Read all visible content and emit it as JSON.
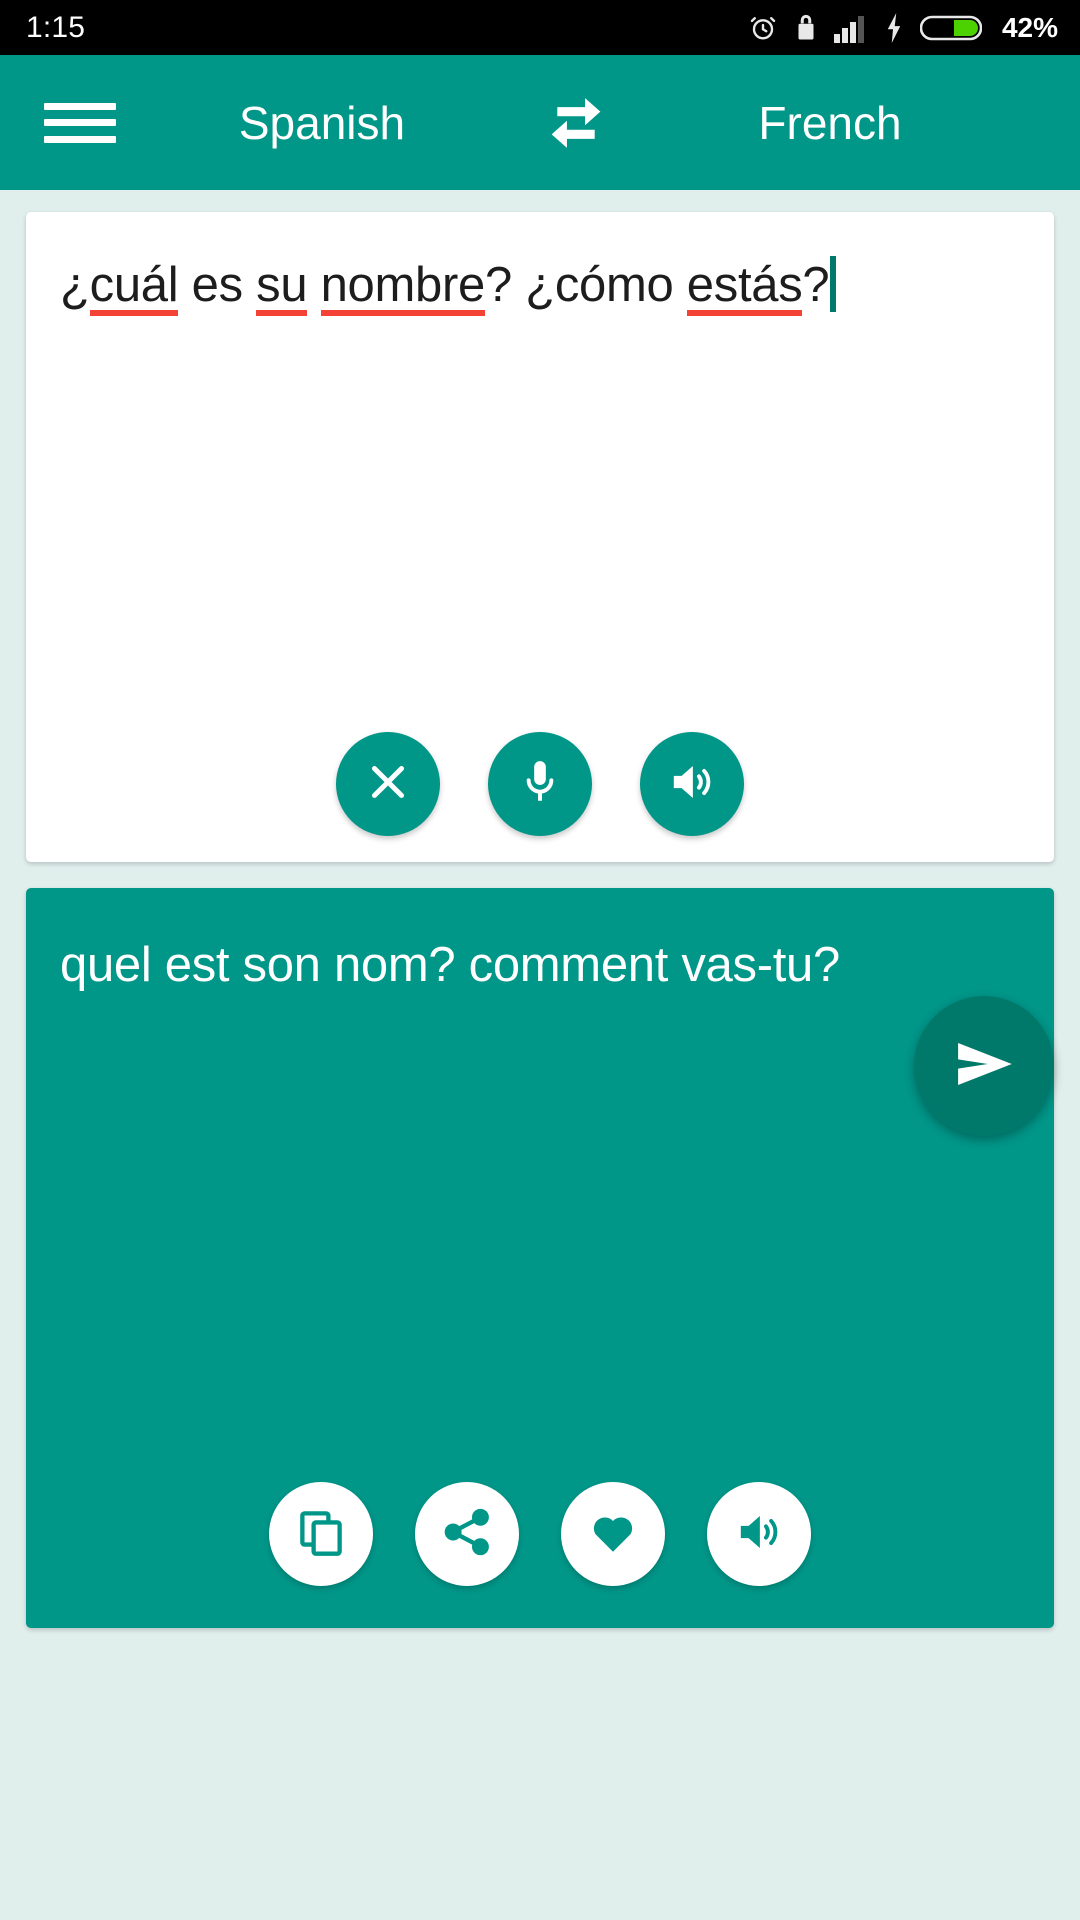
{
  "status_bar": {
    "clock": "1:15",
    "battery_percent": "42%",
    "icons": [
      "alarm-icon",
      "lock-icon",
      "signal-icon",
      "charging-bolt-icon",
      "battery-icon"
    ],
    "background": "#000000",
    "foreground": "#ffffff"
  },
  "app_bar": {
    "menu_label": "menu-icon",
    "source_language": "Spanish",
    "swap_label": "swap-languages-icon",
    "target_language": "French",
    "background": "#009688"
  },
  "source": {
    "text": "¿cuál es su nombre? ¿cómo estás?",
    "segments": [
      {
        "t": "¿",
        "misspelled": false
      },
      {
        "t": "cuál",
        "misspelled": true
      },
      {
        "t": " es ",
        "misspelled": false
      },
      {
        "t": "su",
        "misspelled": true
      },
      {
        "t": " ",
        "misspelled": false
      },
      {
        "t": "nombre",
        "misspelled": true
      },
      {
        "t": "? ¿cómo ",
        "misspelled": false
      },
      {
        "t": "estás",
        "misspelled": true
      },
      {
        "t": "?",
        "misspelled": false
      }
    ],
    "caret_color": "#00796b",
    "spellcheck_color": "#f44336",
    "actions": [
      {
        "name": "clear-button",
        "icon": "close-icon"
      },
      {
        "name": "voice-input-button",
        "icon": "microphone-icon"
      },
      {
        "name": "speak-source-button",
        "icon": "speaker-icon"
      }
    ]
  },
  "target": {
    "text": "quel est son nom? comment vas-tu?",
    "background": "#009688",
    "actions": [
      {
        "name": "copy-button",
        "icon": "copy-icon"
      },
      {
        "name": "share-button",
        "icon": "share-icon"
      },
      {
        "name": "favorite-button",
        "icon": "heart-icon"
      },
      {
        "name": "speak-target-button",
        "icon": "speaker-icon"
      }
    ]
  },
  "send": {
    "label": "send-icon",
    "background": "#00796b"
  },
  "theme": {
    "primary": "#009688",
    "primary_dark": "#00796b",
    "page_background": "#e0eeec",
    "card_background": "#ffffff"
  }
}
